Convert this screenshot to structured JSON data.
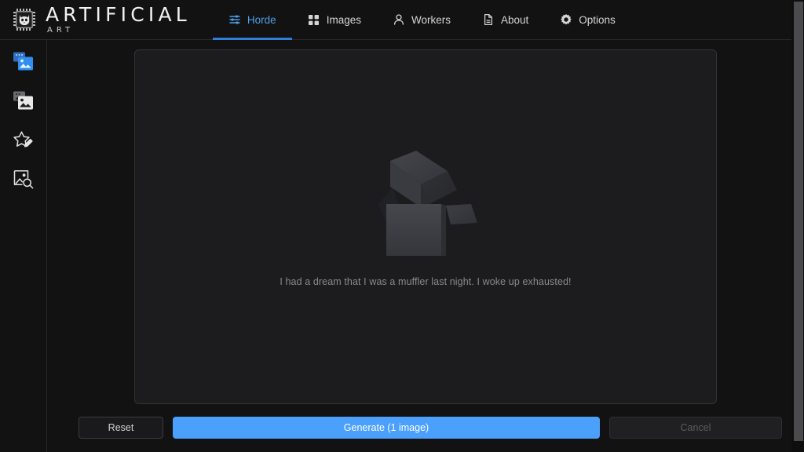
{
  "app": {
    "brand_main": "ARTIFICIAL",
    "brand_sub": "ART",
    "logo_icon": "cat-chip-logo-icon",
    "accent_color": "#4aa0fb",
    "active_tab_color": "#4d9fe8",
    "background_color": "#121212",
    "panel_color": "#1c1c1e"
  },
  "nav": {
    "tabs": [
      {
        "id": "horde",
        "label": "Horde",
        "icon": "sliders-icon",
        "active": true
      },
      {
        "id": "images",
        "label": "Images",
        "icon": "grid-icon",
        "active": false
      },
      {
        "id": "workers",
        "label": "Workers",
        "icon": "person-icon",
        "active": false
      },
      {
        "id": "about",
        "label": "About",
        "icon": "document-icon",
        "active": false
      },
      {
        "id": "options",
        "label": "Options",
        "icon": "gear-icon",
        "active": false
      }
    ]
  },
  "sidebar": {
    "items": [
      {
        "id": "generate",
        "icon": "multi-image-icon",
        "active": true
      },
      {
        "id": "gallery",
        "icon": "multi-image-icon",
        "active": false
      },
      {
        "id": "rate",
        "icon": "star-pencil-icon",
        "active": false
      },
      {
        "id": "interrogate",
        "icon": "image-search-icon",
        "active": false
      }
    ]
  },
  "main": {
    "empty_state": {
      "illustration": "empty-box-icon",
      "message": "I had a dream that I was a muffler last night. I woke up exhausted!"
    }
  },
  "footer": {
    "reset_label": "Reset",
    "generate_label": "Generate (1 image)",
    "cancel_label": "Cancel",
    "cancel_disabled": true
  },
  "scrollbar": {
    "orientation": "vertical",
    "thumb_color": "#4b4b4d"
  }
}
